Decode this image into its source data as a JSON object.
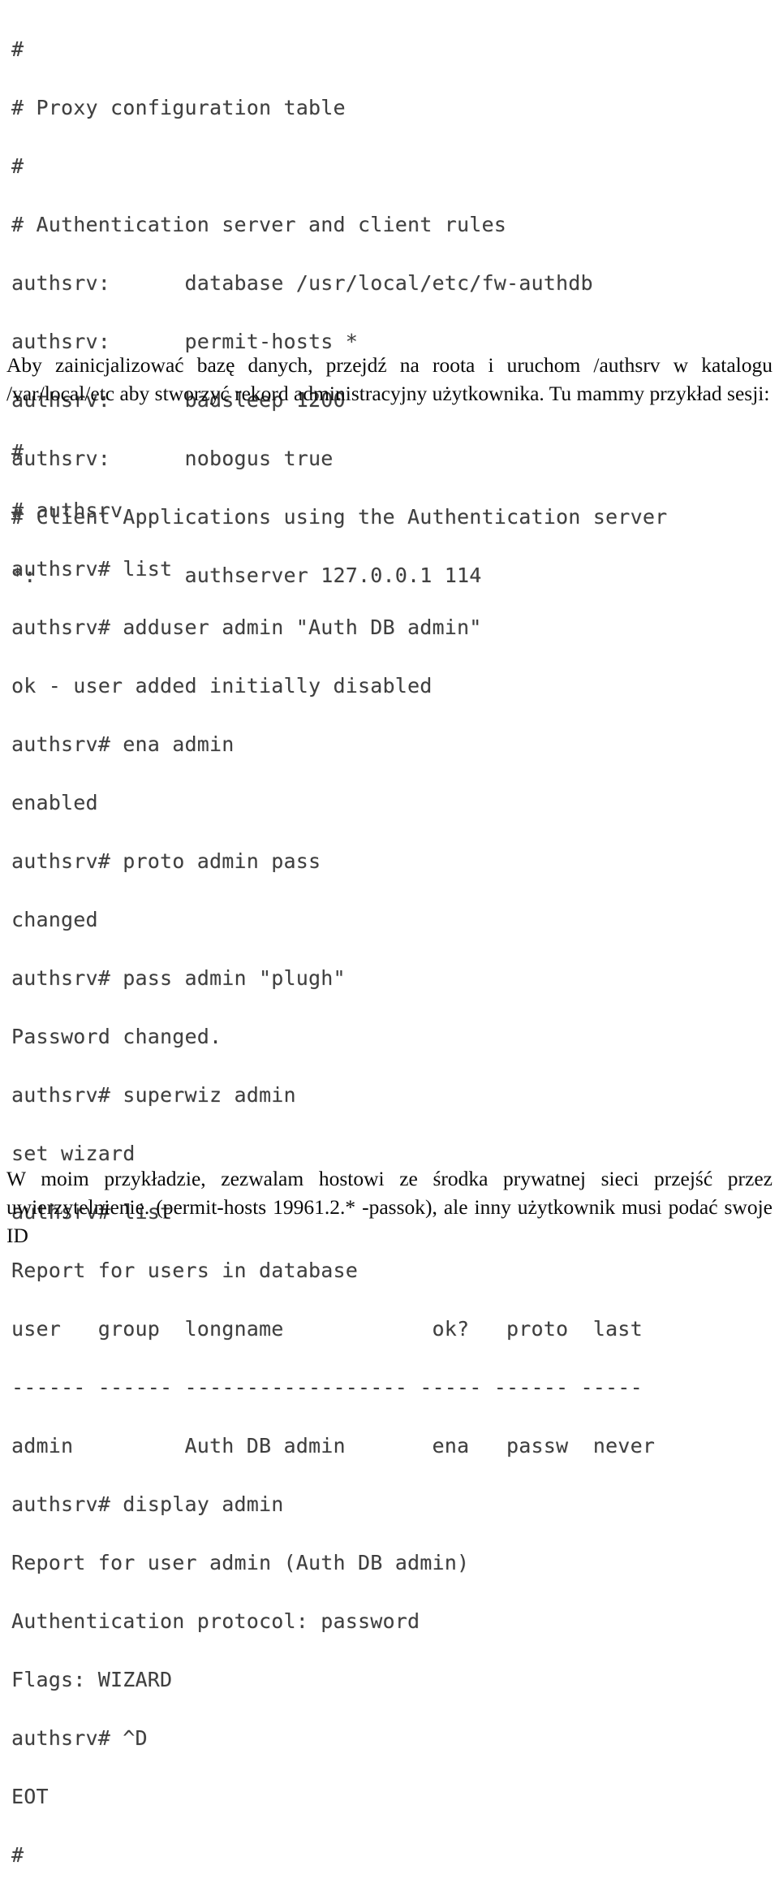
{
  "document": {
    "language": "pl",
    "background_color": "#ffffff",
    "code_text_color": "#3f3f3f",
    "body_text_color": "#0a0a0a"
  },
  "config_block": {
    "name": "proxy-configuration-listing",
    "lines": [
      "#",
      "# Proxy configuration table",
      "#",
      "# Authentication server and client rules",
      "authsrv:      database /usr/local/etc/fw-authdb",
      "authsrv:      permit-hosts *",
      "authsrv:      badsleep 1200",
      "authsrv:      nobogus true",
      "# Client Applications using the Authentication server",
      "*:            authserver 127.0.0.1 114"
    ]
  },
  "intro_paragraph": {
    "text": "Aby zainicjalizować bazę danych, przejdź na roota i uruchom /authsrv w katalogu /var/local/etc aby stworzyć rekord administracyjny użytkownika. Tu mammy przykład sesji:"
  },
  "session_block": {
    "name": "authsrv-session-transcript",
    "lines": [
      "#",
      "# authsrv",
      "authsrv# list",
      "authsrv# adduser admin \"Auth DB admin\"",
      "ok - user added initially disabled",
      "authsrv# ena admin",
      "enabled",
      "authsrv# proto admin pass",
      "changed",
      "authsrv# pass admin \"plugh\"",
      "Password changed.",
      "authsrv# superwiz admin",
      "set wizard",
      "authsrv# list",
      "Report for users in database",
      "user   group  longname            ok?   proto  last",
      "------ ------ ------------------ ----- ------ -----",
      "admin         Auth DB admin       ena   passw  never",
      "authsrv# display admin",
      "Report for user admin (Auth DB admin)",
      "Authentication protocol: password",
      "Flags: WIZARD",
      "authsrv# ^D",
      "EOT",
      "#"
    ],
    "report_table": {
      "title": "Report for users in database",
      "columns": [
        "user",
        "group",
        "longname",
        "ok?",
        "proto",
        "last"
      ],
      "separator": "------ ------ ------------------ ----- ------ -----",
      "rows": [
        {
          "user": "admin",
          "group": "",
          "longname": "Auth DB admin",
          "ok": "ena",
          "proto": "passw",
          "last": "never"
        }
      ]
    },
    "display_report": {
      "header": "Report for user admin (Auth DB admin)",
      "authentication_protocol": "password",
      "flags": "WIZARD"
    }
  },
  "closing_paragraph": {
    "text": "W moim przykładzie, zezwalam hostowi ze środka prywatnej sieci przejść przez uwierzytelnienie. (permit-hosts 19961.2.* -passok), ale inny użytkownik musi podać swoje ID"
  }
}
